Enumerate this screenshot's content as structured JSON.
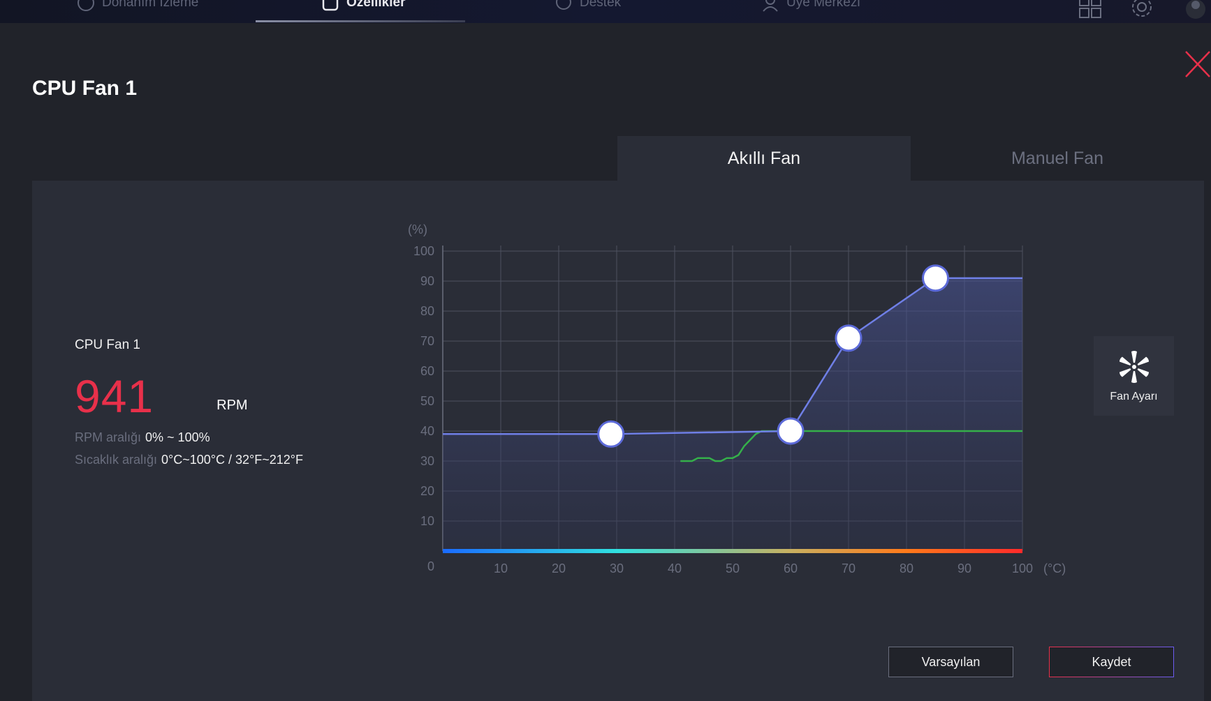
{
  "nav": {
    "items": [
      {
        "label": "Donanım İzleme",
        "icon": "monitor-icon"
      },
      {
        "label": "Özellikler",
        "icon": "features-icon"
      },
      {
        "label": "Destek",
        "icon": "support-icon"
      },
      {
        "label": "Üye Merkezi",
        "icon": "user-icon"
      }
    ]
  },
  "dialog": {
    "title": "CPU Fan 1",
    "tabs": [
      {
        "label": "Akıllı Fan",
        "active": true
      },
      {
        "label": "Manuel Fan",
        "active": false
      }
    ]
  },
  "info": {
    "fan_name": "CPU Fan 1",
    "rpm_value": "941",
    "rpm_unit": "RPM",
    "rpm_range_label": "RPM aralığı",
    "rpm_range_value": "0% ~ 100%",
    "temp_range_label": "Sıcaklık aralığı",
    "temp_range_value": "0°C~100°C / 32°F~212°F"
  },
  "fan_settings": {
    "label": "Fan Ayarı"
  },
  "buttons": {
    "default_label": "Varsayılan",
    "save_label": "Kaydet"
  },
  "chart_data": {
    "type": "line",
    "ylabel": "(%)",
    "xlabel": "(°C)",
    "xlim": [
      0,
      100
    ],
    "ylim": [
      0,
      100
    ],
    "x_ticks": [
      10,
      20,
      30,
      40,
      50,
      60,
      70,
      80,
      90,
      100
    ],
    "y_ticks": [
      0,
      10,
      20,
      30,
      40,
      50,
      60,
      70,
      80,
      90,
      100
    ],
    "grid": true,
    "series": [
      {
        "role": "fan-curve",
        "color": "#6f7fe6",
        "points": [
          [
            0,
            39
          ],
          [
            29,
            39
          ],
          [
            60,
            40
          ],
          [
            70,
            71
          ],
          [
            85,
            91
          ],
          [
            100,
            91
          ]
        ],
        "control_points": [
          [
            29,
            39
          ],
          [
            60,
            40
          ],
          [
            70,
            71
          ],
          [
            85,
            91
          ]
        ]
      },
      {
        "role": "temperature-history",
        "color": "#35b04a",
        "points": [
          [
            41,
            30
          ],
          [
            43,
            30
          ],
          [
            44,
            31
          ],
          [
            46,
            31
          ],
          [
            47,
            30
          ],
          [
            48,
            30
          ],
          [
            49,
            31
          ],
          [
            50,
            31
          ],
          [
            51,
            32
          ],
          [
            52,
            35
          ],
          [
            53,
            37
          ],
          [
            54,
            39
          ],
          [
            55,
            40
          ],
          [
            60,
            40
          ],
          [
            70,
            40
          ],
          [
            80,
            40
          ],
          [
            90,
            40
          ],
          [
            100,
            40
          ]
        ]
      }
    ],
    "colors": {
      "gradient_start": "#1a6bff",
      "gradient_mid": "#30e0e0",
      "gradient_end": "#ff2a2a"
    }
  }
}
